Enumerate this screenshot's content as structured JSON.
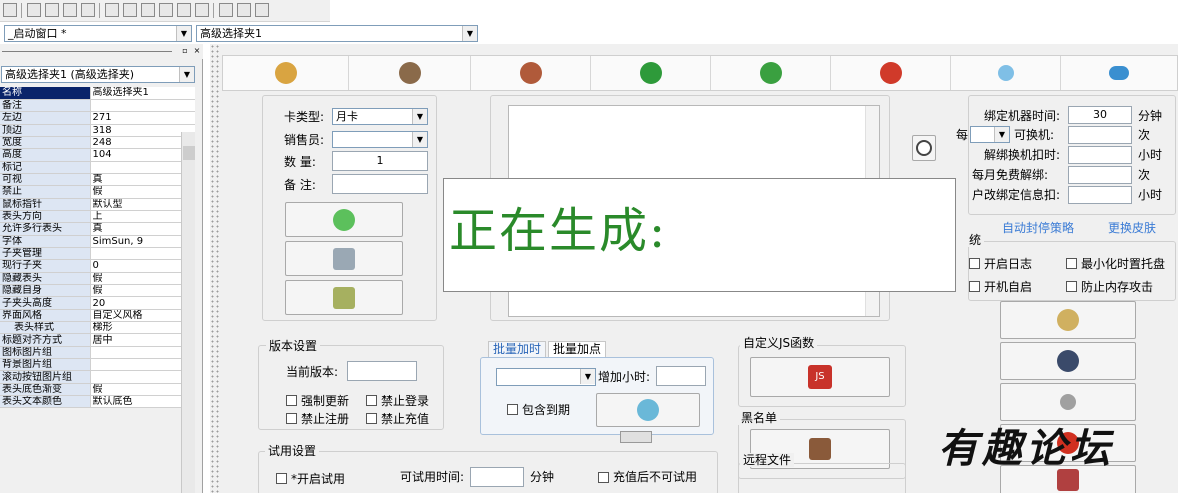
{
  "toolbar": {
    "combo_window": "_启动窗口 *",
    "combo_control": "高级选择夹1"
  },
  "properties": {
    "object_combo": "高级选择夹1 (高级选择夹)",
    "rows": [
      {
        "k": "名称",
        "v": "高级选择夹1"
      },
      {
        "k": "备注",
        "v": ""
      },
      {
        "k": "左边",
        "v": "271"
      },
      {
        "k": "顶边",
        "v": "318"
      },
      {
        "k": "宽度",
        "v": "248"
      },
      {
        "k": "高度",
        "v": "104"
      },
      {
        "k": "标记",
        "v": ""
      },
      {
        "k": "可视",
        "v": "真"
      },
      {
        "k": "禁止",
        "v": "假"
      },
      {
        "k": "鼠标指针",
        "v": "默认型"
      },
      {
        "k": "表头方向",
        "v": "上"
      },
      {
        "k": "允许多行表头",
        "v": "真"
      },
      {
        "k": "字体",
        "v": "SimSun, 9"
      },
      {
        "k": "子夹管理",
        "v": ""
      },
      {
        "k": "现行子夹",
        "v": "0"
      },
      {
        "k": "隐藏表头",
        "v": "假"
      },
      {
        "k": "隐藏自身",
        "v": "假"
      },
      {
        "k": "子夹头高度",
        "v": "20"
      },
      {
        "k": "界面风格",
        "v": "自定义风格"
      },
      {
        "k": "表头样式",
        "v": "梯形"
      },
      {
        "k": "标题对齐方式",
        "v": "居中"
      },
      {
        "k": "图标图片组",
        "v": ""
      },
      {
        "k": "背景图片组",
        "v": ""
      },
      {
        "k": "滚动按钮图片组",
        "v": ""
      },
      {
        "k": "表头底色渐变",
        "v": "假"
      },
      {
        "k": "表头文本颜色",
        "v": "默认底色"
      }
    ]
  },
  "card": {
    "type_label": "卡类型:",
    "type_value": "月卡",
    "seller_label": "销售员:",
    "qty_label": "数  量:",
    "qty_value": "1",
    "note_label": "备  注:"
  },
  "binding": {
    "bind_time_label": "绑定机器时间:",
    "bind_time_value": "30",
    "bind_time_unit": "分钟",
    "every_label": "每",
    "swap_label": "可换机:",
    "swap_unit": "次",
    "unbind_deduct_label": "解绑换机扣时:",
    "unbind_deduct_unit": "小时",
    "monthly_free_label": "每月免费解绑:",
    "monthly_free_unit": "次",
    "user_change_label": "户改绑定信息扣:",
    "user_change_unit": "小时"
  },
  "links": {
    "auto_ban": "自动封停策略",
    "skin": "更换皮肤"
  },
  "system": {
    "title": "统",
    "log": "开启日志",
    "tray": "最小化时置托盘",
    "autostart": "开机自启",
    "anti_mem": "防止内存攻击"
  },
  "version": {
    "title": "版本设置",
    "current_label": "当前版本:",
    "force_update": "强制更新",
    "no_login": "禁止登录",
    "no_register": "禁止注册",
    "no_recharge": "禁止充值"
  },
  "batch": {
    "tab1": "批量加时",
    "tab2": "批量加点",
    "add_hours_label": "增加小时:",
    "include_expired": "包含到期"
  },
  "customjs": {
    "title": "自定义JS函数",
    "js": "JS"
  },
  "blacklist": {
    "title": "黑名单"
  },
  "trial": {
    "title": "试用设置",
    "enable": "*开启试用",
    "time_label": "可试用时间:",
    "time_unit": "分钟",
    "no_after_recharge": "充值后不可试用"
  },
  "remote": {
    "title": "远程文件"
  },
  "overlay": {
    "text": "正在生成:"
  },
  "watermark": "有趣论坛"
}
